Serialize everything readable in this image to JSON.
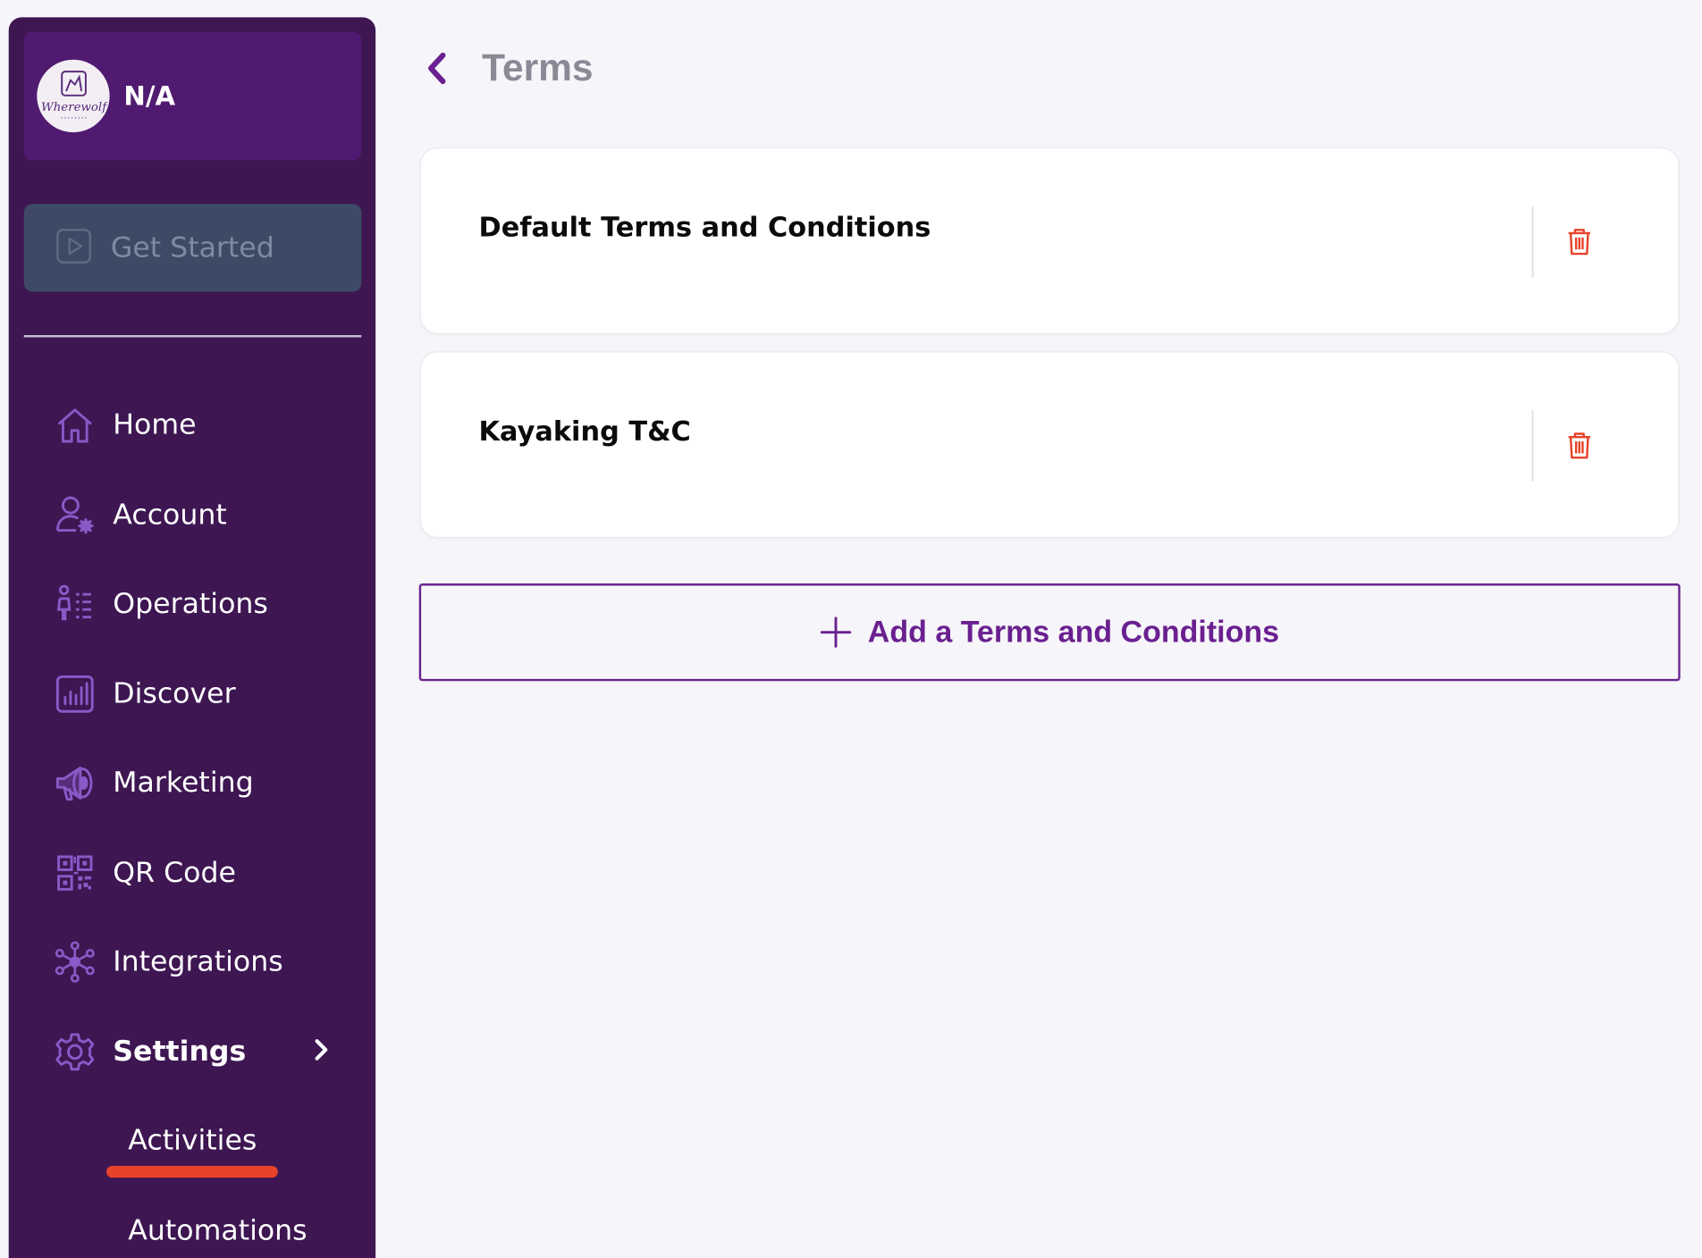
{
  "sidebar": {
    "profile": {
      "name": "N/A",
      "avatar_icon": "wolf-logo-icon",
      "avatar_text": "Wherewolf"
    },
    "get_started": {
      "label": "Get Started",
      "icon": "play-icon"
    },
    "items": [
      {
        "label": "Home",
        "icon": "home-icon"
      },
      {
        "label": "Account",
        "icon": "user-gear-icon"
      },
      {
        "label": "Operations",
        "icon": "operations-icon"
      },
      {
        "label": "Discover",
        "icon": "bar-chart-icon"
      },
      {
        "label": "Marketing",
        "icon": "megaphone-icon"
      },
      {
        "label": "QR Code",
        "icon": "qr-code-icon"
      },
      {
        "label": "Integrations",
        "icon": "integrations-icon"
      },
      {
        "label": "Settings",
        "icon": "gear-icon",
        "active": true
      }
    ],
    "settings_sub": [
      {
        "label": "Activities",
        "highlighted": true
      },
      {
        "label": "Automations"
      }
    ]
  },
  "main": {
    "title": "Terms",
    "terms": [
      {
        "name": "Default Terms and Conditions"
      },
      {
        "name": "Kayaking T&C"
      }
    ],
    "add_button": {
      "label": "Add a Terms and Conditions"
    }
  },
  "colors": {
    "sidebar_bg": "#3d1652",
    "profile_bg": "#501a70",
    "accent": "#6a2590",
    "icon_purple": "#8a59c7",
    "delete_red": "#e8422a",
    "page_bg": "#f6f5f9"
  }
}
